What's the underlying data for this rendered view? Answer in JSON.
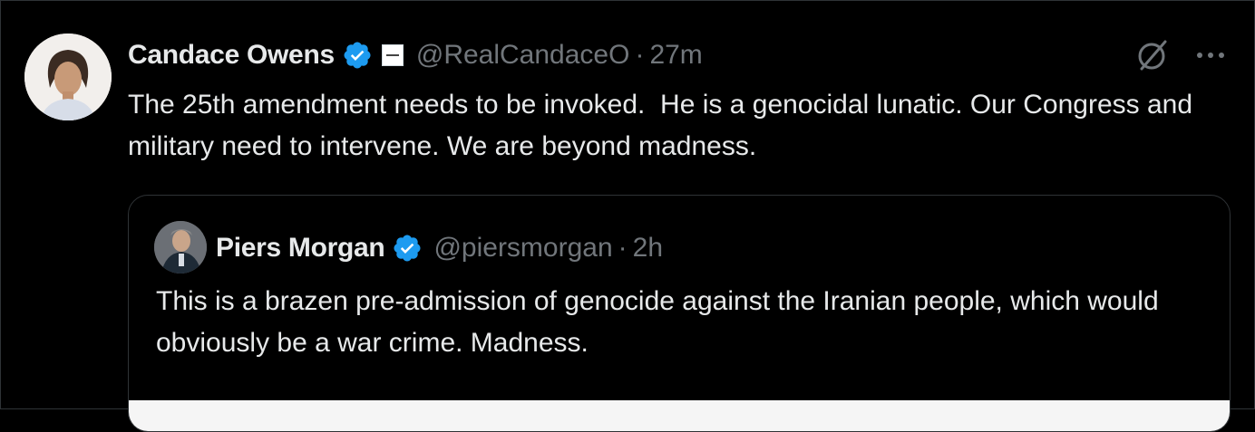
{
  "tweet": {
    "display_name": "Candace Owens",
    "handle": "@RealCandaceO",
    "separator": "·",
    "time": "27m",
    "text": "The 25th amendment needs to be invoked.  He is a genocidal lunatic. Our Congress and military need to intervene. We are beyond madness.",
    "icons": {
      "verified": "verified-badge-icon",
      "affiliation": "affiliation-badge-icon",
      "grok": "grok-icon",
      "more": "more-options-icon"
    }
  },
  "quote": {
    "display_name": "Piers Morgan",
    "handle": "@piersmorgan",
    "separator": "·",
    "time": "2h",
    "text": "This is a brazen pre-admission of genocide against the Iranian people, which would obviously be a war crime. Madness.",
    "icons": {
      "verified": "verified-badge-icon"
    }
  },
  "colors": {
    "background": "#000000",
    "text_primary": "#e7e9ea",
    "text_secondary": "#71767b",
    "verified_blue": "#1d9bf0",
    "border": "#2f3336"
  }
}
